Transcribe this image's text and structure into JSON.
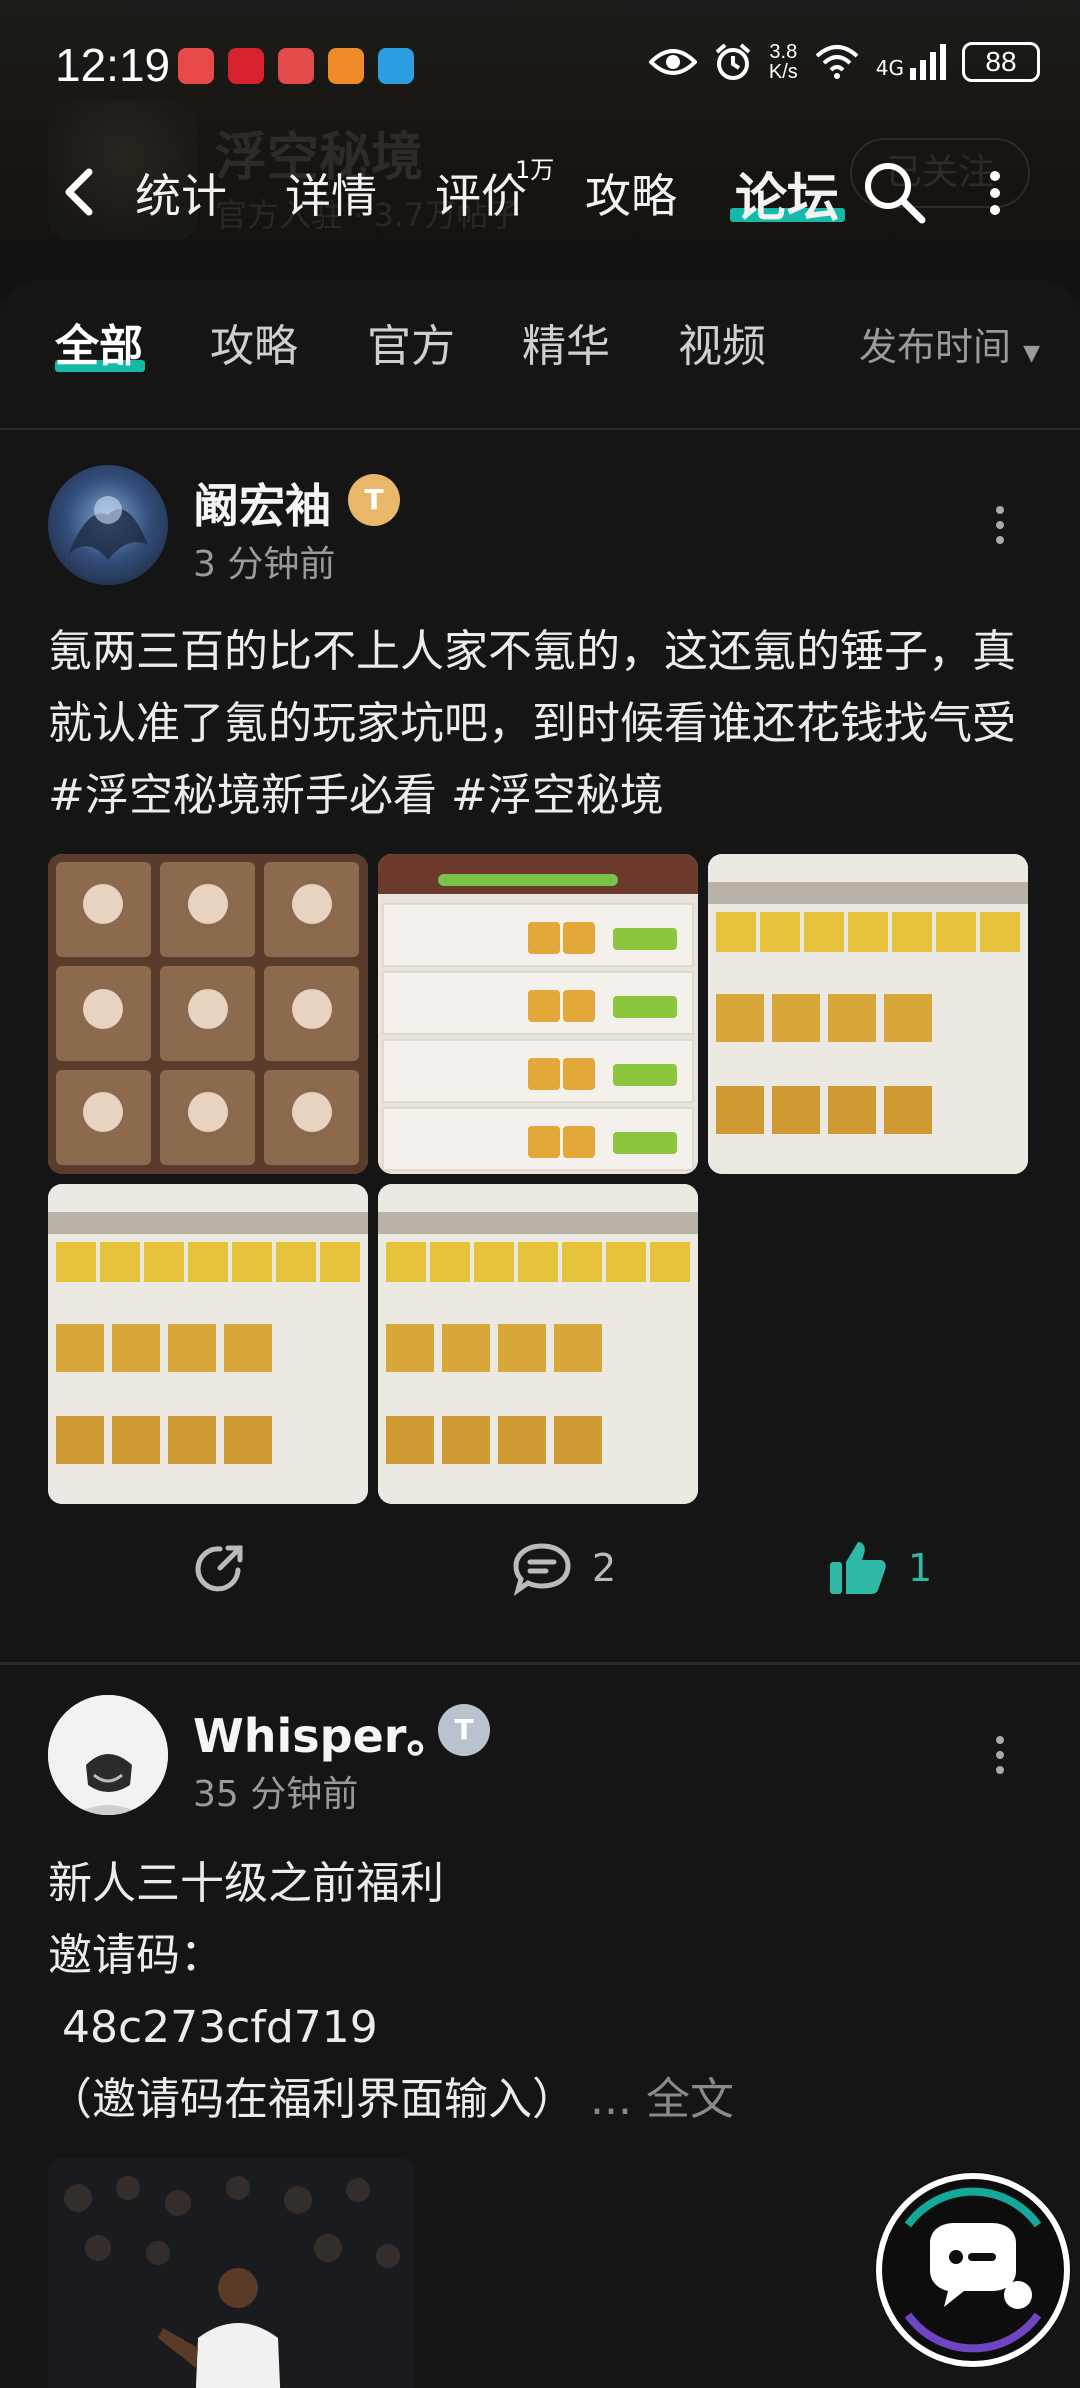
{
  "status": {
    "time": "12:19",
    "speed_value": "3.8",
    "speed_unit": "K/s",
    "network": "4G",
    "battery": "88"
  },
  "app_header": {
    "name": "浮空秘境",
    "subtitle": "官方入驻 · 3.7万帖子",
    "follow": "已关注"
  },
  "nav": {
    "tabs": [
      "统计",
      "详情",
      "评价",
      "攻略",
      "论坛"
    ],
    "review_badge": "1万",
    "active": "论坛"
  },
  "filters": {
    "tabs": [
      "全部",
      "攻略",
      "官方",
      "精华",
      "视频"
    ],
    "sort": "发布时间"
  },
  "posts": [
    {
      "user": "阚宏袖",
      "level": "T",
      "time": "3 分钟前",
      "text": "氪两三百的比不上人家不氪的，这还氪的锤子，真就认准了氪的玩家坑吧，到时候看谁还花钱找气受#浮空秘境新手必看 #浮空秘境",
      "comments": "2",
      "likes": "1"
    },
    {
      "user": "Whisper。",
      "level": "T",
      "time": "35 分钟前",
      "line1": "新人三十级之前福利",
      "line2": "邀请码：",
      "line3": "48c273cfd719",
      "line4": "（邀请码在福利界面输入）",
      "more": "... 全文"
    }
  ],
  "colors": {
    "accent": "#14b9a8",
    "like": "#2fb8a5",
    "level_gold": "#e9b76a",
    "level_silver": "#b9c3cf"
  }
}
